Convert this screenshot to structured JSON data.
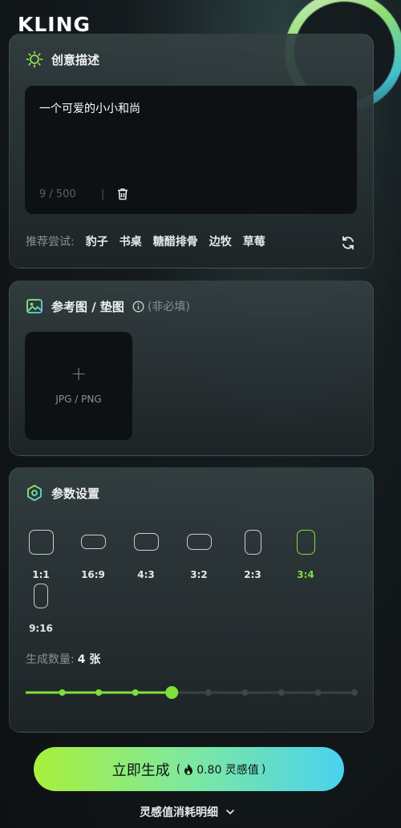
{
  "brand": "KLING",
  "prompt_card": {
    "title": "创意描述",
    "text": "一个可爱的小小和尚",
    "counter": "9 / 500",
    "suggest_label": "推荐尝试:",
    "suggestions": [
      "豹子",
      "书桌",
      "糖醋排骨",
      "边牧",
      "草莓"
    ]
  },
  "ref_card": {
    "title": "参考图 / 垫图",
    "optional": "(非必填)",
    "upload_plus": "+",
    "upload_formats": "JPG / PNG"
  },
  "params_card": {
    "title": "参数设置",
    "ratios": [
      "1:1",
      "16:9",
      "4:3",
      "3:2",
      "2:3",
      "3:4",
      "9:16"
    ],
    "selected_ratio": "3:4",
    "count_label": "生成数量:",
    "count_value": "4 张",
    "slider": {
      "steps": 10,
      "selected_index": 4
    }
  },
  "generate": {
    "label": "立即生成",
    "cost_open": "(",
    "cost_value": "0.80 灵感值",
    "cost_close": ")"
  },
  "footer": {
    "detail_link": "灵感值消耗明细"
  },
  "colors": {
    "accent_green": "#7ee03a",
    "button_start": "#a8f03b",
    "button_end": "#4ad2ee"
  }
}
